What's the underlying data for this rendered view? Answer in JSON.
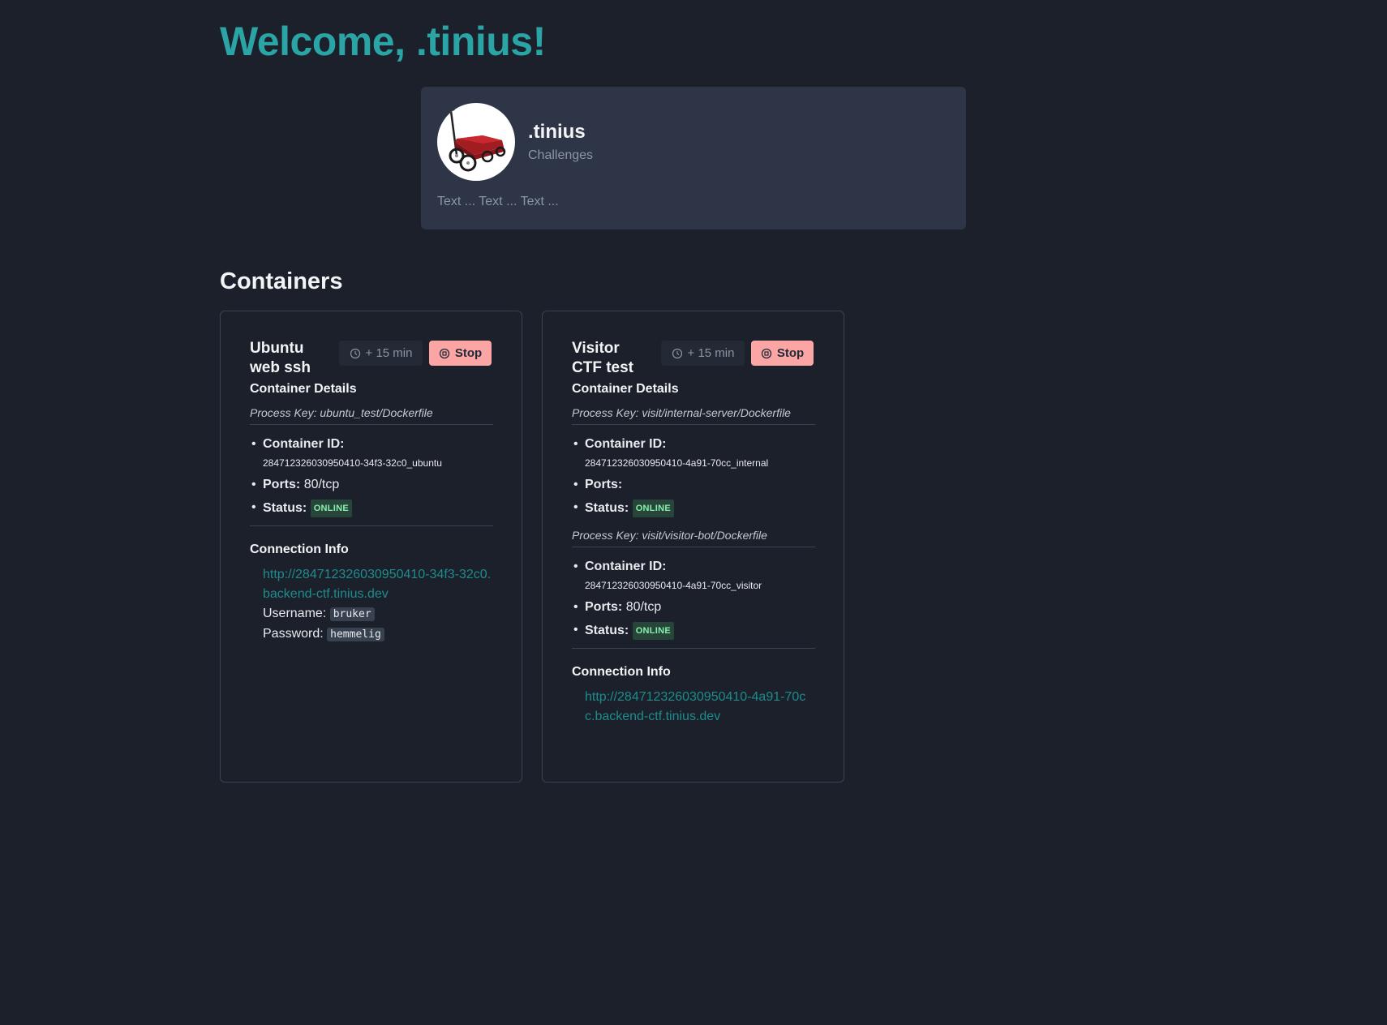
{
  "header": {
    "welcome": "Welcome, .tinius!"
  },
  "profile": {
    "name": ".tinius",
    "subtitle": "Challenges",
    "bio": "Text ... Text ... Text ..."
  },
  "containers_title": "Containers",
  "containers": [
    {
      "title": "Ubuntu web ssh",
      "extend_label": "+ 15 min",
      "stop_label": "Stop",
      "details_title": "Container Details",
      "processes": [
        {
          "process_key": "Process Key: ubuntu_test/Dockerfile",
          "container_id_label": "Container ID:",
          "container_id": "284712326030950410-34f3-32c0_ubuntu",
          "ports_label": "Ports:",
          "ports": "80/tcp",
          "status_label": "Status:",
          "status": "ONLINE"
        }
      ],
      "connection_title": "Connection Info",
      "connection_url": "http://284712326030950410-34f3-32c0.backend-ctf.tinius.dev",
      "username_label": "Username:",
      "username": "bruker",
      "password_label": "Password:",
      "password": "hemmelig"
    },
    {
      "title": "Visitor CTF test",
      "extend_label": "+ 15 min",
      "stop_label": "Stop",
      "details_title": "Container Details",
      "processes": [
        {
          "process_key": "Process Key: visit/internal-server/Dockerfile",
          "container_id_label": "Container ID:",
          "container_id": "284712326030950410-4a91-70cc_internal",
          "ports_label": "Ports:",
          "ports": "",
          "status_label": "Status:",
          "status": "ONLINE"
        },
        {
          "process_key": "Process Key: visit/visitor-bot/Dockerfile",
          "container_id_label": "Container ID:",
          "container_id": "284712326030950410-4a91-70cc_visitor",
          "ports_label": "Ports:",
          "ports": "80/tcp",
          "status_label": "Status:",
          "status": "ONLINE"
        }
      ],
      "connection_title": "Connection Info",
      "connection_url": "http://284712326030950410-4a91-70cc.backend-ctf.tinius.dev"
    }
  ],
  "colors": {
    "background": "#1b202b",
    "accent": "#2aa4a4",
    "card": "#2d3546",
    "stop_button": "#fca5a5",
    "online_badge": "#86efac"
  },
  "icons": {
    "extend": "clock-icon",
    "stop": "stop-circle-icon",
    "avatar": "red-wagon-image"
  }
}
